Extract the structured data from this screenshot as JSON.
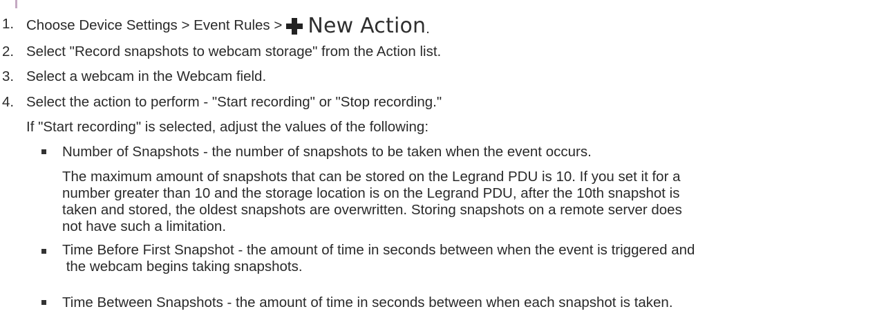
{
  "steps": [
    {
      "number": "1.",
      "text": "Choose Device Settings > Event Rules >",
      "button_label": "New Action",
      "trailing": "."
    },
    {
      "number": "2.",
      "text": "Select \"Record snapshots to webcam storage\" from the Action list."
    },
    {
      "number": "3.",
      "text": "Select a webcam in the Webcam field."
    },
    {
      "number": "4.",
      "text": "Select the action to perform - \"Start recording\" or \"Stop recording.\""
    }
  ],
  "step4_note": "If \"Start recording\" is selected, adjust the values of the following:",
  "bullets": [
    {
      "text": "Number of Snapshots - the number of snapshots to be taken when the event occurs.",
      "detail_lines": [
        "The maximum amount of snapshots that can be stored on the Legrand PDU is 10. If you set it for a",
        "number greater than 10 and the storage location is on the Legrand PDU, after the 10th snapshot is",
        "taken and stored, the oldest snapshots are overwritten. Storing snapshots on a remote server does",
        "not have such a limitation."
      ]
    },
    {
      "text_lines": [
        "Time Before First Snapshot - the amount of time in seconds between when the event is triggered and",
        " the webcam begins taking snapshots."
      ]
    },
    {
      "text": "Time Between Snapshots - the amount of time in seconds between when each snapshot is taken."
    }
  ],
  "icons": {
    "new_action_icon": "plus-icon"
  }
}
